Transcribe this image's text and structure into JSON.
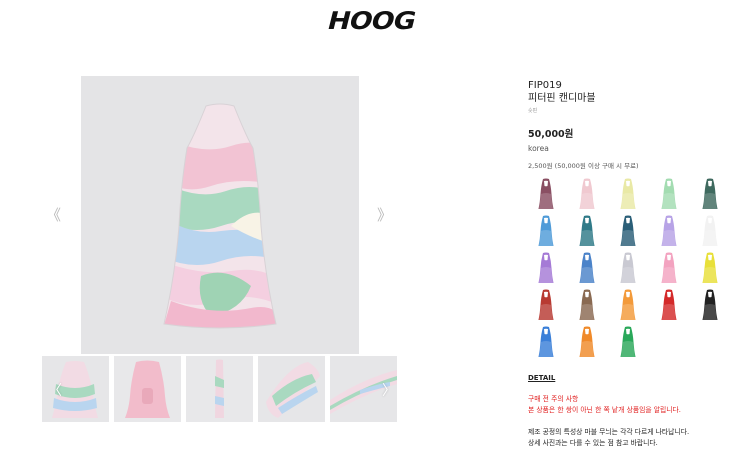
{
  "brand": {
    "logo_text": "HOOG"
  },
  "gallery": {
    "prev_icon": "《",
    "next_icon": "》",
    "thumb_next_icon": "〉",
    "thumb_prev_icon": "〈"
  },
  "product": {
    "code": "FIP019",
    "name": "피터핀 캔디마블",
    "sub_label": "숏핀",
    "price": "50,000원",
    "origin": "korea",
    "shipping": "2,500원 (50,000원 이상 구매 시 무료)"
  },
  "swatches": [
    {
      "name": "plum",
      "color": "#8a4f63"
    },
    {
      "name": "light-pink",
      "color": "#f0c9d0"
    },
    {
      "name": "light-yellow",
      "color": "#e9e9a6"
    },
    {
      "name": "mint",
      "color": "#a3dcb1"
    },
    {
      "name": "dark-green",
      "color": "#3f6a5f"
    },
    {
      "name": "sky-blue",
      "color": "#4f9bd8"
    },
    {
      "name": "teal",
      "color": "#2f7a88"
    },
    {
      "name": "navy-teal",
      "color": "#2b5f78"
    },
    {
      "name": "lavender",
      "color": "#b7a3e6"
    },
    {
      "name": "white",
      "color": "#f2f2f2"
    },
    {
      "name": "purple-white",
      "color": "#a57ad6"
    },
    {
      "name": "blue-white",
      "color": "#4b83c9"
    },
    {
      "name": "grey-white",
      "color": "#c9c9d2"
    },
    {
      "name": "pink-orange",
      "color": "#f3a3c0"
    },
    {
      "name": "yellow-green",
      "color": "#e8e03a"
    },
    {
      "name": "red-white",
      "color": "#b83a32"
    },
    {
      "name": "brown-blue",
      "color": "#8a6a52"
    },
    {
      "name": "orange-cyan",
      "color": "#f39a3a"
    },
    {
      "name": "red-stripe",
      "color": "#d42a2a"
    },
    {
      "name": "black-stripe",
      "color": "#222222"
    },
    {
      "name": "blue-marble",
      "color": "#3a7fd8"
    },
    {
      "name": "orange-marble",
      "color": "#f08a2a"
    },
    {
      "name": "rainbow-marble",
      "color": "#2aa85a"
    }
  ],
  "detail": {
    "label": "DETAIL",
    "warning_title": "구매 전 주의 사항",
    "warning_text": "본 상품은 한 쌍이 아닌 한 쪽 낱개 상품임을 알립니다.",
    "note_line1": "제조 공정의 특성상 마블 무늬는 각각 다르게 나타납니다.",
    "note_line2": "상세 사진과는 다를 수 있는 점 참고 바랍니다."
  }
}
